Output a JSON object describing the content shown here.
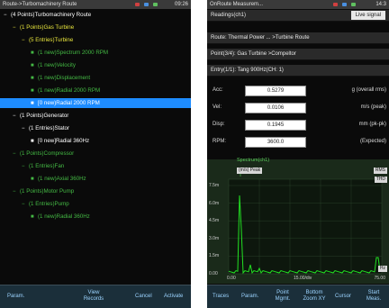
{
  "left_screen": {
    "status": {
      "title": "Route->Turbomachinery Route",
      "clock": "09:26"
    },
    "tree": [
      {
        "text": "(4 Points)Turbomachinery Route",
        "indent": 0,
        "color": "#ffffff",
        "sel": false
      },
      {
        "text": "(1 Points)Gas Turbine",
        "indent": 1,
        "color": "#e8e53c",
        "sel": false
      },
      {
        "text": "(5 Entries)Turbine",
        "indent": 2,
        "color": "#e8e53c",
        "sel": false
      },
      {
        "text": "(1 new)Spectrum 2000 RPM",
        "indent": 3,
        "color": "#44b944",
        "sel": false
      },
      {
        "text": "(1 new)Velocity",
        "indent": 3,
        "color": "#44b944",
        "sel": false
      },
      {
        "text": "(1 new)Displacement",
        "indent": 3,
        "color": "#44b944",
        "sel": false
      },
      {
        "text": "(1 new)Radial 2000 RPM",
        "indent": 3,
        "color": "#44b944",
        "sel": false
      },
      {
        "text": "[0 new)Radial 2000 RPM",
        "indent": 3,
        "color": "#ffffff",
        "sel": true
      },
      {
        "text": "(1 Points)Generator",
        "indent": 1,
        "color": "#ffffff",
        "sel": false
      },
      {
        "text": "(1 Entries)Stator",
        "indent": 2,
        "color": "#ffffff",
        "sel": false
      },
      {
        "text": "[0 new]Radial 360Hz",
        "indent": 3,
        "color": "#ffffff",
        "sel": false
      },
      {
        "text": "(1 Points)Compressor",
        "indent": 1,
        "color": "#44b944",
        "sel": false
      },
      {
        "text": "(1 Entries)Fan",
        "indent": 2,
        "color": "#44b944",
        "sel": false
      },
      {
        "text": "(1 new)Axial 360Hz",
        "indent": 3,
        "color": "#44b944",
        "sel": false
      },
      {
        "text": "(1 Points)Motor Pump",
        "indent": 1,
        "color": "#44b944",
        "sel": false
      },
      {
        "text": "(1 Entries)Pump",
        "indent": 2,
        "color": "#44b944",
        "sel": false
      },
      {
        "text": "(1 new)Radial 360Hz",
        "indent": 3,
        "color": "#44b944",
        "sel": false
      }
    ],
    "buttons": {
      "param": "Param.",
      "view_records": "View Records",
      "cancel": "Cancel",
      "activate": "Activate"
    }
  },
  "right_screen": {
    "status": {
      "title": "OnRoute Measurem...",
      "clock": "14:3"
    },
    "readings": "Readings(ch1)",
    "live_signal": "Live signal",
    "route": "Route: Thermal Power ... >Turbine Route",
    "point": "Point(3/4): Gas Turbine >Compeltor",
    "entry": "Entry(1/1): Tang 900Hz(CH: 1)",
    "measurements": [
      {
        "label": "Acc:",
        "value": "0.5279",
        "unit": "g (overall rms)"
      },
      {
        "label": "Vel:",
        "value": "0.0106",
        "unit": "m/s (peak)"
      },
      {
        "label": "Disp:",
        "value": "0.1945",
        "unit": "mm (pk-pk)"
      },
      {
        "label": "RPM:",
        "value": "3600.0",
        "unit": "(Expected)"
      }
    ],
    "spectrum": {
      "title": "Spectrum(ch1)",
      "legend": "(m/s) Peak",
      "tag_rms": "RMS",
      "tag_thd": "THD",
      "tag_hz": "Hz",
      "x_ticks": [
        "0.00",
        "15.00/div",
        "75.00"
      ],
      "y_ticks": [
        "7.5m",
        "6.0m",
        "4.5m",
        "3.0m",
        "1.5m",
        "0.00"
      ]
    },
    "buttons": {
      "traces": "Traces",
      "param": "Param.",
      "point_mgmt": "Point Mgmt.",
      "bottom_zoom": "Bottom Zoom XY",
      "cursor": "Cursor",
      "start_meas": "Start Meas."
    }
  }
}
